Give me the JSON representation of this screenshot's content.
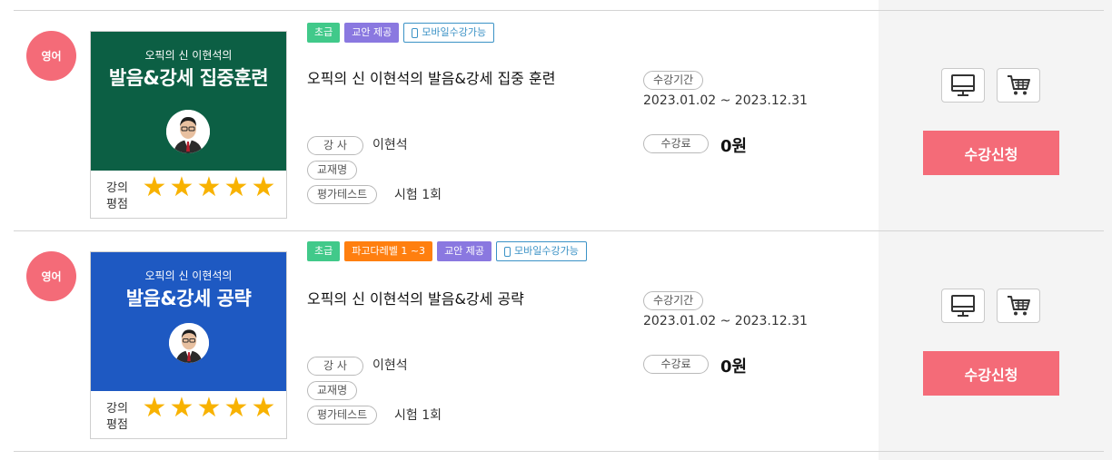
{
  "courses": [
    {
      "language": "영어",
      "banner_sub": "오픽의 신 이현석의",
      "banner_main": "발음&강세 집중훈련",
      "banner_color": "#0c5f44",
      "rating_label": "강의 평점",
      "rating": 5,
      "rating_max": 5,
      "badges": [
        "초급",
        "교안 제공",
        "모바일수강가능"
      ],
      "title": "오픽의 신 이현석의 발음&강세 집중 훈련",
      "period_label": "수강기간",
      "period": "2023.01.02 ~ 2023.12.31",
      "fee_label": "수강료",
      "fee": "0원",
      "instructor_label": "강 사",
      "instructor": "이현석",
      "textbook_label": "교재명",
      "test_label": "평가테스트",
      "test": "시험 1회",
      "apply_label": "수강신청",
      "pc_icon": "monitor-icon",
      "cart_icon": "cart-icon"
    },
    {
      "language": "영어",
      "banner_sub": "오픽의 신 이현석의",
      "banner_main": "발음&강세 공략",
      "banner_color": "#1e59c2",
      "rating_label": "강의 평점",
      "rating": 5,
      "rating_max": 5,
      "badges": [
        "초급",
        "파고다레벨 1 ~3",
        "교안 제공",
        "모바일수강가능"
      ],
      "title": "오픽의 신 이현석의 발음&강세 공략",
      "period_label": "수강기간",
      "period": "2023.01.02 ~ 2023.12.31",
      "fee_label": "수강료",
      "fee": "0원",
      "instructor_label": "강 사",
      "instructor": "이현석",
      "textbook_label": "교재명",
      "test_label": "평가테스트",
      "test": "시험 1회",
      "apply_label": "수강신청",
      "pc_icon": "monitor-icon",
      "cart_icon": "cart-icon"
    }
  ],
  "colors": {
    "accent": "#f46b78",
    "badge_level": "#41c98a",
    "badge_material": "#8a78e0",
    "badge_pagoda": "#ff7f0f",
    "badge_mobile": "#3b92c6",
    "star": "#f8b200"
  }
}
